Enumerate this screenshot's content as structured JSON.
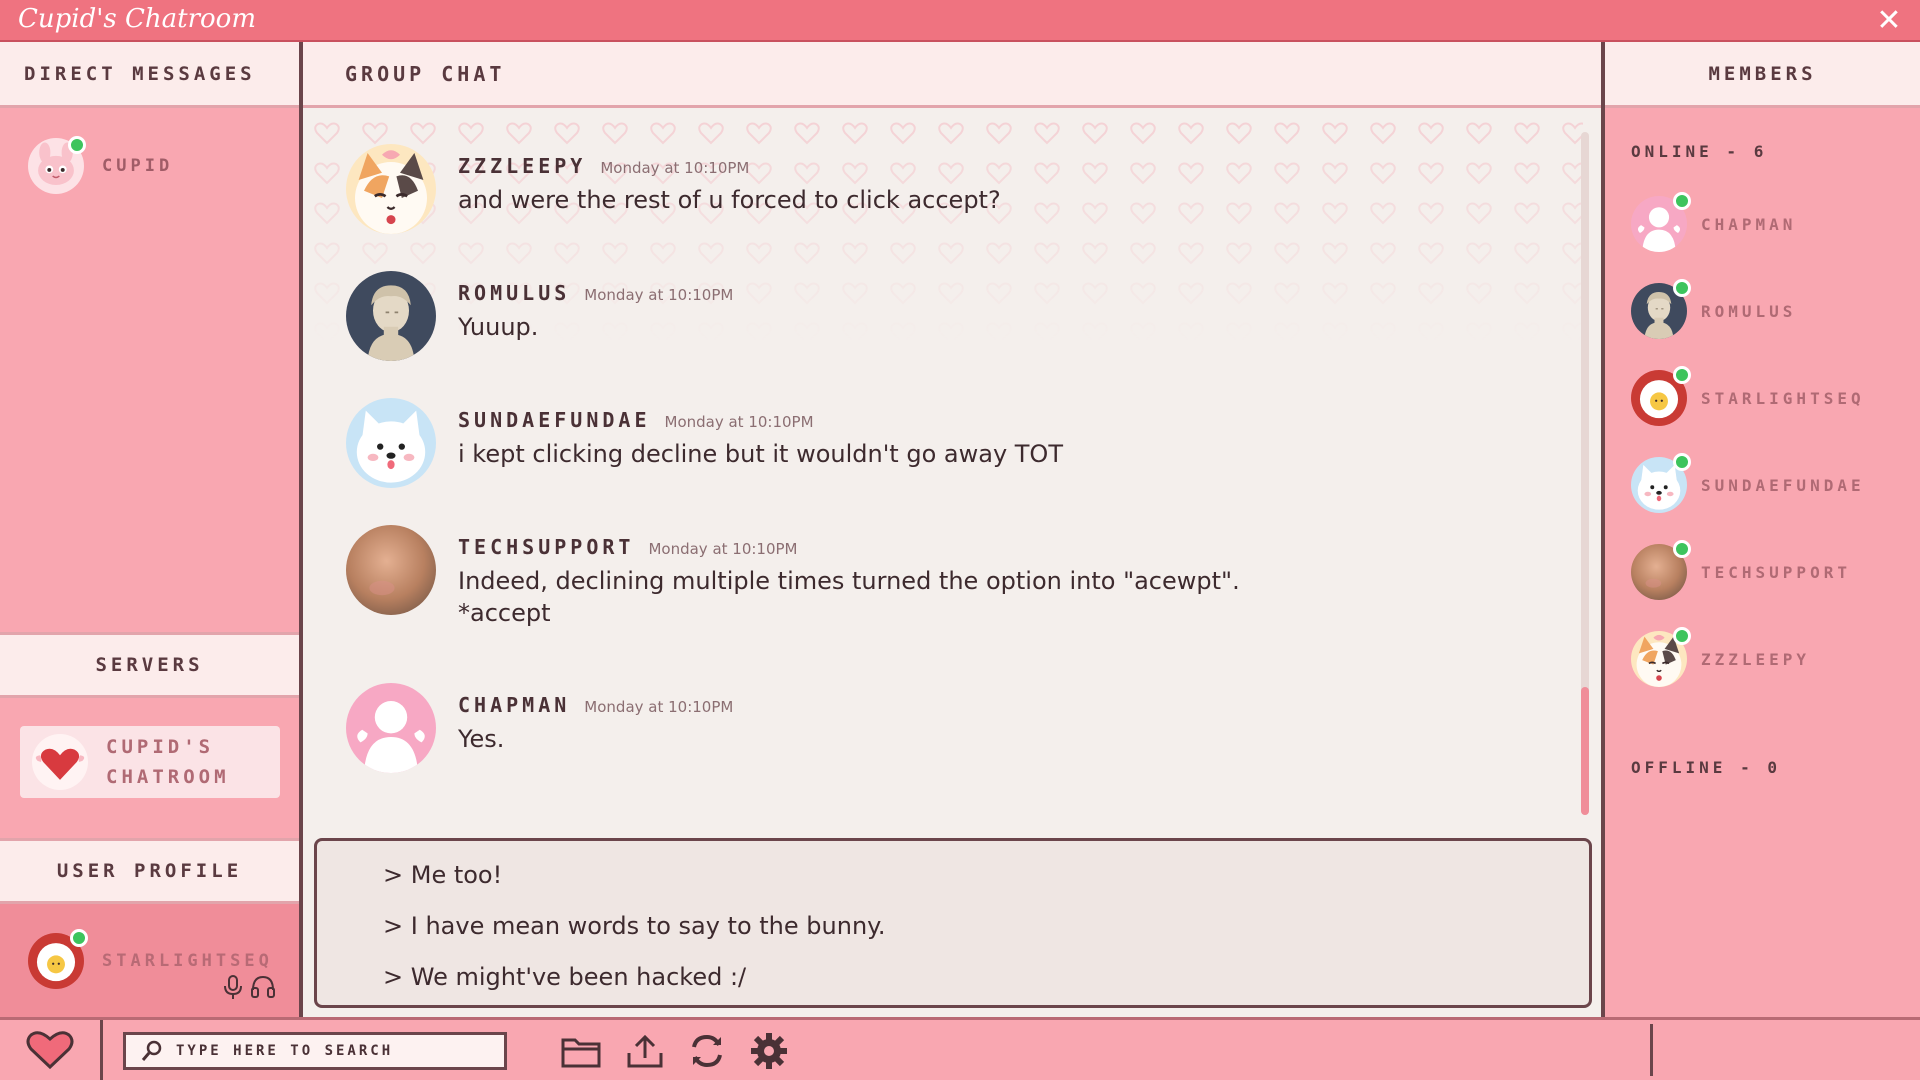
{
  "app": {
    "title": "Cupid's Chatroom",
    "close_icon": "close-icon"
  },
  "direct_messages": {
    "header": "DIRECT MESSAGES",
    "items": [
      {
        "name": "CUPID",
        "online": true
      }
    ]
  },
  "servers": {
    "header": "SERVERS",
    "items": [
      {
        "name_line1": "CUPID'S",
        "name_line2": "CHATROOM"
      }
    ]
  },
  "user_profile": {
    "header": "USER PROFILE",
    "name": "STARLIGHTSEQ",
    "online": true,
    "icons": [
      "microphone-icon",
      "headset-icon"
    ]
  },
  "group_chat": {
    "header": "GROUP CHAT",
    "messages": [
      {
        "author": "ZZZLEEPY",
        "time": "Monday at 10:10PM",
        "lines": [
          "and were the rest of u forced to click accept?"
        ]
      },
      {
        "author": "ROMULUS",
        "time": "Monday at 10:10PM",
        "lines": [
          "Yuuup."
        ]
      },
      {
        "author": "SUNDAEFUNDAE",
        "time": "Monday at 10:10PM",
        "lines": [
          "i kept clicking decline but it wouldn't go away TOT"
        ]
      },
      {
        "author": "TECHSUPPORT",
        "time": "Monday at 10:10PM",
        "lines": [
          "Indeed, declining multiple times turned the option into \"acewpt\".",
          "*accept"
        ]
      },
      {
        "author": "CHAPMAN",
        "time": "Monday at 10:10PM",
        "lines": [
          "Yes."
        ]
      }
    ],
    "composer_options": [
      "> Me too!",
      "> I have mean words to say to the bunny.",
      "> We might've been hacked :/"
    ]
  },
  "members": {
    "header": "MEMBERS",
    "online_label": "ONLINE - 6",
    "offline_label": "OFFLINE - 0",
    "online": [
      "CHAPMAN",
      "ROMULUS",
      "STARLIGHTSEQ",
      "SUNDAEFUNDAE",
      "TECHSUPPORT",
      "ZZZLEEPY"
    ]
  },
  "taskbar": {
    "search_placeholder": "TYPE HERE TO SEARCH",
    "icons": [
      "heart-icon",
      "search-icon",
      "folder-icon",
      "upload-icon",
      "refresh-icon",
      "gear-icon"
    ]
  },
  "colors": {
    "accent": "#ef7380",
    "online": "#3dc45d",
    "panel": "#f9a7b1",
    "border": "#6b454b"
  }
}
